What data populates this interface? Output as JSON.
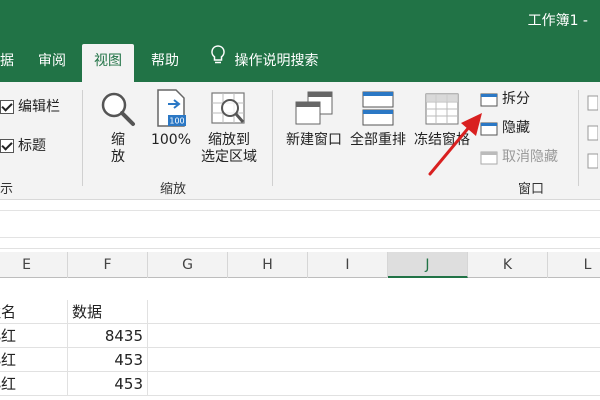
{
  "window": {
    "title": "工作簿1 -"
  },
  "tabs": [
    {
      "label": "据"
    },
    {
      "label": "审阅"
    },
    {
      "label": "视图"
    },
    {
      "label": "帮助"
    }
  ],
  "tell_me": {
    "label": "操作说明搜索",
    "icon": "lightbulb-icon"
  },
  "show_group": {
    "items": [
      {
        "label": "编辑栏",
        "checked": true
      },
      {
        "label": "标题",
        "checked": true
      }
    ],
    "label": "示"
  },
  "zoom_group": {
    "label": "缩放",
    "zoom_label": "缩\n放",
    "zoom_line1": "缩",
    "zoom_line2": "放",
    "percent_label": "100%",
    "percent_icon_text": "100",
    "fit_line1": "缩放到",
    "fit_line2": "选定区域"
  },
  "window_group": {
    "label": "窗口",
    "new_window": "新建窗口",
    "arrange_all": "全部重排",
    "freeze_panes": "冻结窗格",
    "split": "拆分",
    "hide": "隐藏",
    "unhide": "取消隐藏"
  },
  "columns": [
    "E",
    "F",
    "G",
    "H",
    "I",
    "J",
    "K",
    "L"
  ],
  "selected_column": "J",
  "rows": [
    {
      "e": "姓名",
      "f": "数据"
    },
    {
      "e": "小红",
      "f": "8435"
    },
    {
      "e": "小红",
      "f": "453"
    },
    {
      "e": "小红",
      "f": "453"
    }
  ],
  "colors": {
    "accent": "#217346",
    "ribbon_bg": "#f3f3f3",
    "annotation_arrow": "#d92020"
  }
}
